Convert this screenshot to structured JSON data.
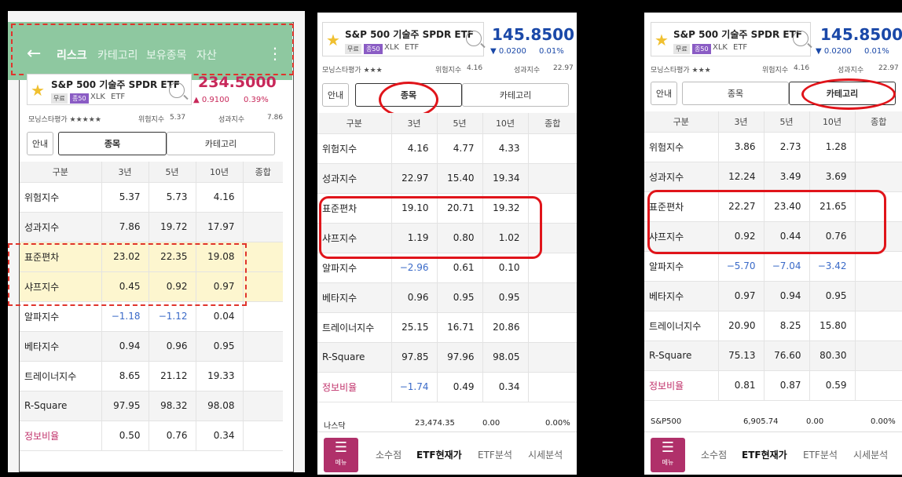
{
  "panels": [
    {
      "top_tabs": [
        "리스크",
        "카테고리",
        "보유종목",
        "자산"
      ],
      "stock": {
        "name": "S&P 500 기술주 SPDR ETF",
        "badge1": "무료",
        "badge2": "종50",
        "ticker": "XLK",
        "type": "ETF",
        "price": "234.5000",
        "change": "▲ 0.9100",
        "change_pct": "0.39%"
      },
      "rating": "모닝스타평가 ★★★★★",
      "risk_label": "위험지수",
      "risk_value": "5.37",
      "perf_label": "성과지수",
      "perf_value": "7.86",
      "info_button": "안내",
      "toggle_left": "종목",
      "toggle_right": "카테고리",
      "columns": [
        "구분",
        "3년",
        "5년",
        "10년",
        "종합"
      ],
      "rows": [
        [
          "위험지수",
          "5.37",
          "5.73",
          "4.16"
        ],
        [
          "성과지수",
          "7.86",
          "19.72",
          "17.97"
        ],
        [
          "표준편차",
          "23.02",
          "22.35",
          "19.08"
        ],
        [
          "샤프지수",
          "0.45",
          "0.92",
          "0.97"
        ],
        [
          "알파지수",
          "−1.18",
          "−1.12",
          "0.04"
        ],
        [
          "베타지수",
          "0.94",
          "0.96",
          "0.95"
        ],
        [
          "트레이너지수",
          "8.65",
          "21.12",
          "19.33"
        ],
        [
          "R-Square",
          "97.95",
          "98.32",
          "98.08"
        ],
        [
          "정보비율",
          "0.50",
          "0.76",
          "0.34"
        ]
      ]
    },
    {
      "stock": {
        "name": "S&P 500 기술주 SPDR ETF",
        "badge1": "무료",
        "badge2": "종50",
        "ticker": "XLK",
        "type": "ETF",
        "price": "145.8500",
        "change": "▼ 0.0200",
        "change_pct": "0.01%"
      },
      "rating": "모닝스타평가 ★★★",
      "risk_label": "위험지수",
      "risk_value": "4.16",
      "perf_label": "성과지수",
      "perf_value": "22.97",
      "info_button": "안내",
      "toggle_left": "종목",
      "toggle_right": "카테고리",
      "columns": [
        "구분",
        "3년",
        "5년",
        "10년",
        "종합"
      ],
      "rows": [
        [
          "위험지수",
          "4.16",
          "4.77",
          "4.33"
        ],
        [
          "성과지수",
          "22.97",
          "15.40",
          "19.34"
        ],
        [
          "표준편차",
          "19.10",
          "20.71",
          "19.32"
        ],
        [
          "샤프지수",
          "1.19",
          "0.80",
          "1.02"
        ],
        [
          "알파지수",
          "−2.96",
          "0.61",
          "0.10"
        ],
        [
          "베타지수",
          "0.96",
          "0.95",
          "0.95"
        ],
        [
          "트레이너지수",
          "25.15",
          "16.71",
          "20.86"
        ],
        [
          "R-Square",
          "97.85",
          "97.96",
          "98.05"
        ],
        [
          "정보비율",
          "−1.74",
          "0.49",
          "0.34"
        ]
      ],
      "index_row": {
        "name": "나스닥",
        "value": "23,474.35",
        "change": "0.00",
        "pct": "0.00%"
      },
      "nav": {
        "menu": "메뉴",
        "items": [
          "소수점",
          "ETF현재가",
          "ETF분석",
          "시세분석"
        ]
      }
    },
    {
      "stock": {
        "name": "S&P 500 기술주 SPDR ETF",
        "badge1": "무료",
        "badge2": "종50",
        "ticker": "XLK",
        "type": "ETF",
        "price": "145.8500",
        "change": "▼ 0.0200",
        "change_pct": "0.01%"
      },
      "rating": "모닝스타평가 ★★★",
      "risk_label": "위험지수",
      "risk_value": "4.16",
      "perf_label": "성과지수",
      "perf_value": "22.97",
      "info_button": "안내",
      "toggle_left": "종목",
      "toggle_right": "카테고리",
      "columns": [
        "구분",
        "3년",
        "5년",
        "10년",
        "종합"
      ],
      "rows": [
        [
          "위험지수",
          "3.86",
          "2.73",
          "1.28"
        ],
        [
          "성과지수",
          "12.24",
          "3.49",
          "3.69"
        ],
        [
          "표준편차",
          "22.27",
          "23.40",
          "21.65"
        ],
        [
          "샤프지수",
          "0.92",
          "0.44",
          "0.76"
        ],
        [
          "알파지수",
          "−5.70",
          "−7.04",
          "−3.42"
        ],
        [
          "베타지수",
          "0.97",
          "0.94",
          "0.95"
        ],
        [
          "트레이너지수",
          "20.90",
          "8.25",
          "15.80"
        ],
        [
          "R-Square",
          "75.13",
          "76.60",
          "80.30"
        ],
        [
          "정보비율",
          "0.81",
          "0.87",
          "0.59"
        ]
      ],
      "index_row": {
        "name": "S&P500",
        "value": "6,905.74",
        "change": "0.00",
        "pct": "0.00%"
      },
      "nav": {
        "menu": "메뉴",
        "items": [
          "소수점",
          "ETF현재가",
          "ETF분석",
          "시세분석"
        ]
      }
    }
  ],
  "colors": {
    "header_green": "#8ec8a0",
    "negative_blue": "#3a6ac8",
    "pink_label": "#c0306a",
    "price_red": "#c8285a",
    "price_blue": "#1a48a8",
    "annotation_red": "#e0141a"
  }
}
